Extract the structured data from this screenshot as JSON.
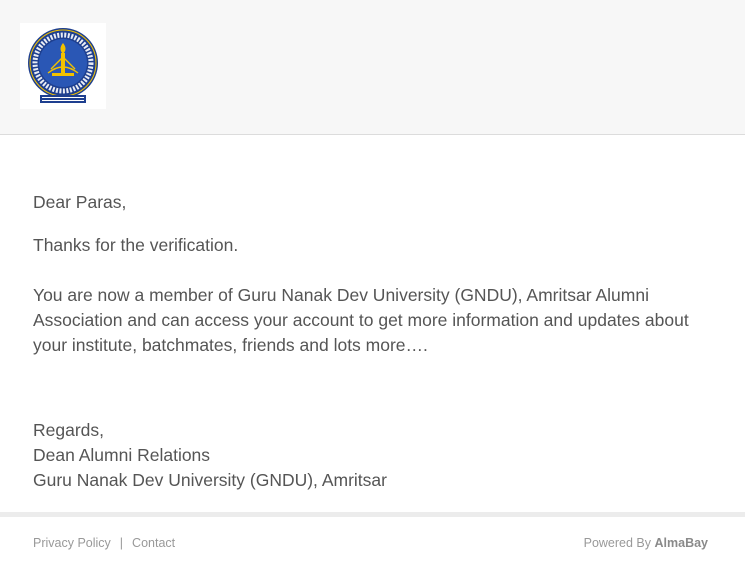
{
  "greeting": "Dear Paras,",
  "thanks": "Thanks for the verification.",
  "body": "You are now a member of Guru Nanak Dev University (GNDU), Amritsar Alumni Association and can access your account to get more information and updates about your institute, batchmates, friends and lots more….",
  "signature": {
    "regards": "Regards,",
    "title": "Dean Alumni Relations",
    "org": "Guru Nanak Dev University (GNDU), Amritsar"
  },
  "footer": {
    "privacy": "Privacy Policy",
    "separator": "|",
    "contact": "Contact",
    "powered_prefix": "Powered By",
    "powered_brand": "AlmaBay"
  },
  "logo": {
    "icon": "gndu-emblem-icon",
    "colors": {
      "primary": "#1e3f8f",
      "accent": "#f2c200"
    }
  }
}
